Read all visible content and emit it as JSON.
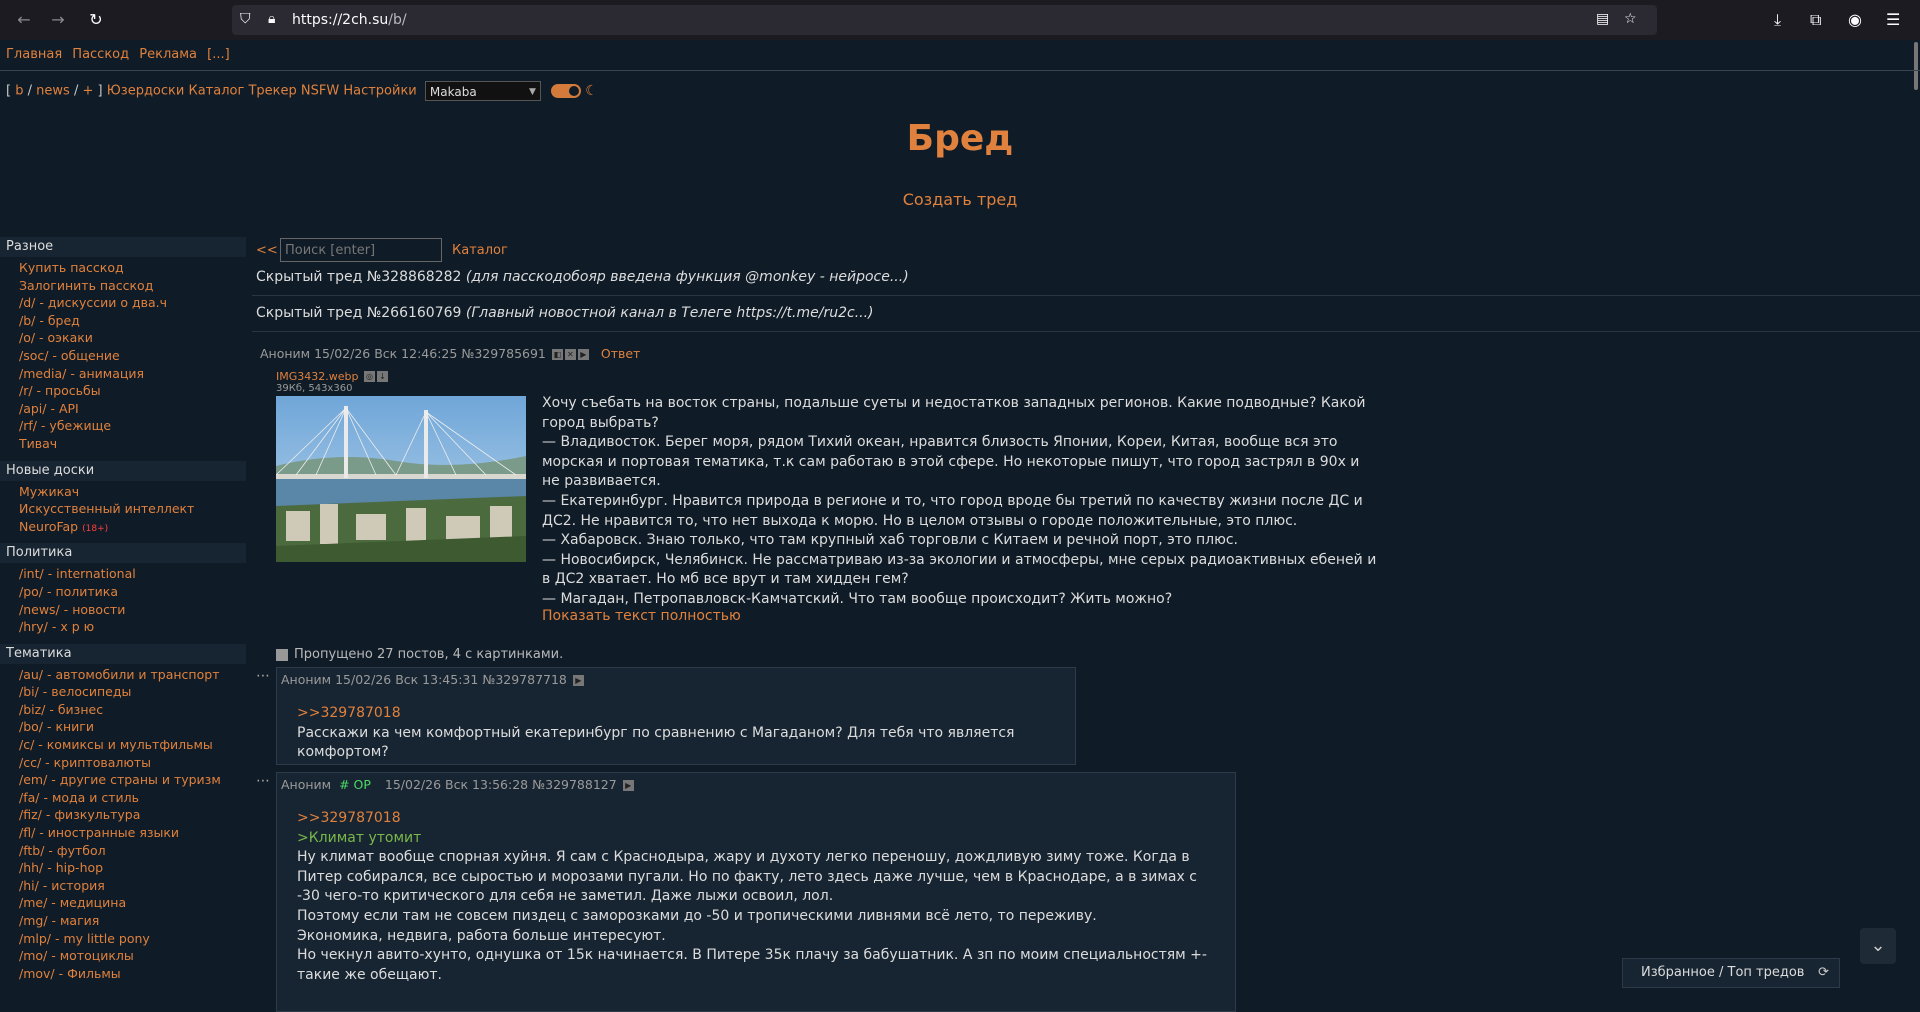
{
  "browser": {
    "url_host": "https://2ch.su",
    "url_path": "/b/"
  },
  "topnav": {
    "items": [
      "Главная",
      "Пасскод",
      "Реклама",
      "[...]"
    ]
  },
  "boardnav": {
    "open": "[",
    "boards": [
      "b",
      "news",
      "+"
    ],
    "sep": "/",
    "close": "]",
    "links": [
      "Юзердоски",
      "Каталог",
      "Трекер",
      "NSFW",
      "Настройки"
    ],
    "style_value": "Makaba"
  },
  "board": {
    "title": "Бред",
    "create_thread": "Создать тред"
  },
  "sidebar": {
    "groups": [
      {
        "title": "Разное",
        "items": [
          "Купить пасскод",
          "Залогинить пасскод",
          "/d/ - дискуссии о два.ч",
          "/b/ - бред",
          "/o/ - оэкаки",
          "/soc/ - общение",
          "/media/ - анимация",
          "/r/ - просьбы",
          "/api/ - API",
          "/rf/ - убежище",
          "Тивач"
        ]
      },
      {
        "title": "Новые доски",
        "items": [
          "Мужикач",
          "Искусственный интеллект",
          "NeuroFap"
        ],
        "tag18": "(18+)"
      },
      {
        "title": "Политика",
        "items": [
          "/int/ - international",
          "/po/ - политика",
          "/news/ - новости",
          "/hry/ - х р ю"
        ]
      },
      {
        "title": "Тематика",
        "items": [
          "/au/ - автомобили и транспорт",
          "/bi/ - велосипеды",
          "/biz/ - бизнес",
          "/bo/ - книги",
          "/c/ - комиксы и мультфильмы",
          "/cc/ - криптовалюты",
          "/em/ - другие страны и туризм",
          "/fa/ - мода и стиль",
          "/fiz/ - физкультура",
          "/fl/ - иностранные языки",
          "/ftb/ - футбол",
          "/hh/ - hip-hop",
          "/hi/ - история",
          "/me/ - медицина",
          "/mg/ - магия",
          "/mlp/ - my little pony",
          "/mo/ - мотоциклы",
          "/mov/ - Фильмы"
        ]
      }
    ]
  },
  "search": {
    "back": "<<",
    "placeholder": "Поиск [enter]",
    "catalog": "Каталог"
  },
  "hidden_threads": [
    {
      "label": "Скрытый тред №328868282",
      "excerpt": "(для пасскодобояр введена функция @monkey - нейросе...)"
    },
    {
      "label": "Скрытый тред №266160769",
      "excerpt": "(Главный новостной канал в Телеге https://t.me/ru2c...)"
    }
  ],
  "op": {
    "name": "Аноним",
    "date": "15/02/26 Вск 12:46:25",
    "num": "№329785691",
    "reply": "Ответ",
    "file_name": "IMG3432.webp",
    "file_dims": "39Кб, 543x360",
    "lines": [
      "Хочу съебать на восток страны, подальше суеты и недостатков западных регионов. Какие подводные? Какой город выбрать?",
      "— Владивосток. Берег моря, рядом Тихий океан, нравится близость Японии, Кореи, Китая, вообще вся это морская и портовая тематика, т.к сам работаю в этой сфере. Но некоторые пишут, что город застрял в 90х и не развивается.",
      "— Екатеринбург. Нравится природа в регионе и то, что город вроде бы третий по качеству жизни после ДС и ДС2. Не нравится то, что нет выхода к морю. Но в целом отзывы о городе положительные, это плюс.",
      "— Хабаровск. Знаю только, что там крупный хаб торговли с Китаем и речной порт, это плюс.",
      "— Новосибирск, Челябинск. Не рассматриваю из-за экологии и атмосферы, мне серых радиоактивных ебеней и в ДС2 хватает. Но мб все врут и там хидден гем?",
      "— Магадан, Петропавловск-Камчатский. Что там вообще происходит? Жить можно?"
    ],
    "show_full": "Показать текст полностью"
  },
  "skipped": "Пропущено 27 постов, 4 с картинками.",
  "replies": [
    {
      "name": "Аноним",
      "date": "15/02/26 Вск 13:45:31",
      "num": "№329787718",
      "quote": ">>329787018",
      "lines": [
        "Расскажи ка чем комфортный екатеринбург по сравнению с Магаданом? Для тебя что является комфортом?"
      ]
    },
    {
      "name": "Аноним",
      "op_tag": "# OP",
      "date": "15/02/26 Вск 13:56:28",
      "num": "№329788127",
      "quote": ">>329787018",
      "green": ">Климат утомит",
      "lines": [
        "Ну климат вообще спорная хуйня. Я сам с Краснодыра, жару и духоту легко переношу, дождливую зиму тоже. Когда в Питер собирался, все сыростью и морозами пугали. Но по факту, лето здесь даже лучше, чем в Краснодаре, а в зимах с -30 чего-то критического для себя не заметил. Даже лыжи освоил, лол.",
        "Поэтому если там не совсем пиздец с заморозками до -50 и тропическими ливнями всё лето, то переживу.",
        "Экономика, недвига, работа больше интересуют.",
        "Но чекнул авито-хунто, однушка от 15к начинается. В Питере 35к плачу за бабушатник. А зп по моим специальностям +- такие же обещают."
      ]
    }
  ],
  "bottom_bar": {
    "fav": "Избранное",
    "sep": "/",
    "top": "Топ тредов"
  },
  "colors": {
    "accent": "#e0813d",
    "background": "#0f1b26",
    "op_green": "#4cd964"
  }
}
